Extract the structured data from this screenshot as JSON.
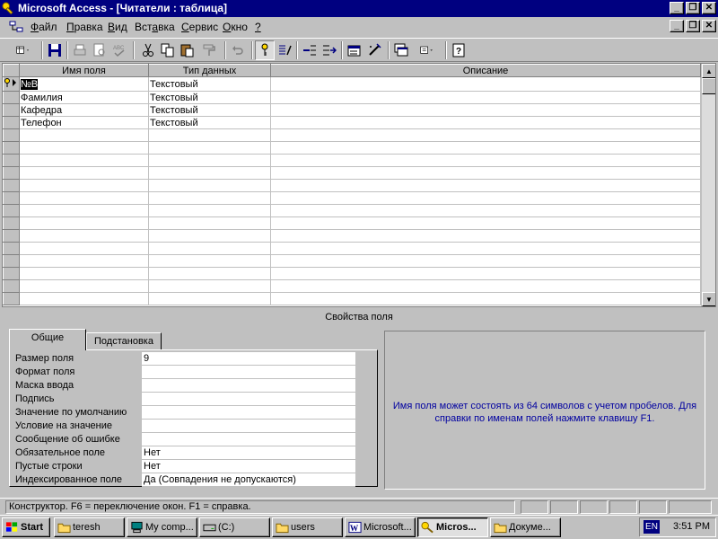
{
  "window": {
    "title": "Microsoft Access - [Читатели : таблица]",
    "minimize": "_",
    "restore": "❐",
    "close": "✕"
  },
  "menu": {
    "items": [
      {
        "label": "Файл",
        "u": "Ф",
        "rest": "айл"
      },
      {
        "label": "Правка",
        "u": "П",
        "rest": "равка"
      },
      {
        "label": "Вид",
        "u": "В",
        "rest": "ид"
      },
      {
        "label": "Вставка",
        "pre": "Вст",
        "u": "а",
        "rest": "вка"
      },
      {
        "label": "Сервис",
        "u": "С",
        "rest": "ервис"
      },
      {
        "label": "Окно",
        "u": "О",
        "rest": "кно"
      },
      {
        "label": "?",
        "u": "?",
        "rest": ""
      }
    ]
  },
  "toolbar": {
    "icons": [
      "view-icon",
      "save-icon",
      "print-icon",
      "print-preview-icon",
      "spelling-icon",
      "cut-icon",
      "copy-icon",
      "paste-icon",
      "format-painter-icon",
      "undo-icon",
      "primary-key-icon",
      "indexes-icon",
      "insert-rows-icon",
      "delete-rows-icon",
      "properties-icon",
      "build-icon",
      "database-window-icon",
      "new-object-icon",
      "help-icon"
    ]
  },
  "grid": {
    "headers": [
      "Имя поля",
      "Тип данных",
      "Описание"
    ],
    "rows": [
      {
        "name": "№В",
        "type": "Текстовый",
        "description": "",
        "key": true
      },
      {
        "name": "Фамилия",
        "type": "Текстовый",
        "description": ""
      },
      {
        "name": "Кафедра",
        "type": "Текстовый",
        "description": ""
      },
      {
        "name": "Телефон",
        "type": "Текстовый",
        "description": ""
      }
    ],
    "empty_rows": 14
  },
  "properties": {
    "header": "Свойства поля",
    "tabs": [
      "Общие",
      "Подстановка"
    ],
    "items": [
      {
        "label": "Размер поля",
        "value": "9"
      },
      {
        "label": "Формат поля",
        "value": ""
      },
      {
        "label": "Маска ввода",
        "value": ""
      },
      {
        "label": "Подпись",
        "value": ""
      },
      {
        "label": "Значение по умолчанию",
        "value": ""
      },
      {
        "label": "Условие на значение",
        "value": ""
      },
      {
        "label": "Сообщение об ошибке",
        "value": ""
      },
      {
        "label": "Обязательное поле",
        "value": "Нет"
      },
      {
        "label": "Пустые строки",
        "value": "Нет"
      },
      {
        "label": "Индексированное поле",
        "value": "Да (Совпадения не допускаются)"
      }
    ],
    "help_text": "Имя поля может состоять из 64 символов с учетом пробелов.  Для справки по именам полей нажмите клавишу F1."
  },
  "status": {
    "text": "Конструктор.  F6 = переключение окон.  F1 = справка."
  },
  "taskbar": {
    "start": "Start",
    "tasks": [
      {
        "label": "teresh",
        "icon": "folder-icon"
      },
      {
        "label": "My comp...",
        "icon": "computer-icon"
      },
      {
        "label": "(C:)",
        "icon": "drive-icon"
      },
      {
        "label": "users",
        "icon": "folder-icon"
      },
      {
        "label": "Microsoft...",
        "icon": "word-icon"
      },
      {
        "label": "Micros...",
        "icon": "access-icon",
        "active": true
      },
      {
        "label": "Докуме...",
        "icon": "folder-icon"
      }
    ],
    "lang": "EN",
    "clock": "3:51 PM"
  },
  "colors": {
    "titlebar": "#000080",
    "face": "#c0c0c0",
    "help_text": "#0000a0"
  }
}
